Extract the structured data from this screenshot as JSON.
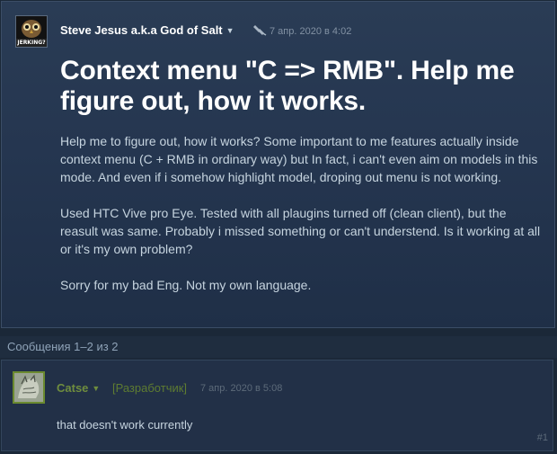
{
  "op": {
    "author": "Steve Jesus a.k.a God of Salt",
    "avatar_text": "JERKING?",
    "date": "7 апр. 2020 в 4:02",
    "title": "Context menu \"C => RMB\". Help me figure out, how it works.",
    "paragraphs": [
      "Help me to figure out, how it works? Some important to me features actually inside context menu (C + RMB in ordinary way) but In fact, i can't even aim on models in this mode. And even if i somehow highlight model, droping out menu is not working.",
      "Used HTC Vive pro Eye. Tested with all plaugins turned off (clean client), but the reasult was same. Probably i missed something or can't understend. Is it working at all or it's my own problem?",
      "Sorry for my bad Eng. Not my own language."
    ]
  },
  "count_text": "Сообщения 1–2 из 2",
  "reply": {
    "author": "Catse",
    "badge": "[Разработчик]",
    "date": "7 апр. 2020 в 5:08",
    "text": "that doesn't work currently",
    "number": "#1"
  },
  "icons": {
    "author_dropdown": "chevron-down-icon",
    "pin": "pin-icon"
  }
}
